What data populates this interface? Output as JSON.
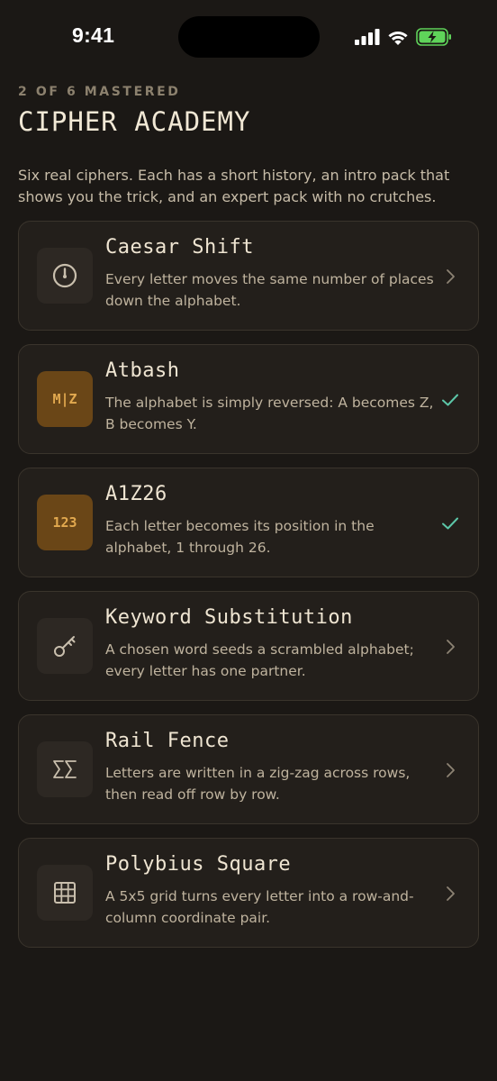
{
  "status_bar": {
    "time": "9:41"
  },
  "header": {
    "progress": "2 OF 6 MASTERED",
    "title": "CIPHER ACADEMY",
    "intro": "Six real ciphers. Each has a short history, an intro pack that shows you the trick, and an expert pack with no crutches."
  },
  "ciphers": [
    {
      "title": "Caesar Shift",
      "desc": "Every letter moves the same number of places down the alphabet.",
      "icon": "dial-icon",
      "mastered": false
    },
    {
      "title": "Atbash",
      "desc": "The alphabet is simply reversed: A becomes Z, B becomes Y.",
      "icon": "mirror-az-icon",
      "icon_text": "M|Z",
      "mastered": true
    },
    {
      "title": "A1Z26",
      "desc": "Each letter becomes its position in the alphabet, 1 through 26.",
      "icon": "numbers-icon",
      "icon_text": "123",
      "mastered": true
    },
    {
      "title": "Keyword Substitution",
      "desc": "A chosen word seeds a scrambled alphabet; every letter has one partner.",
      "icon": "key-icon",
      "mastered": false
    },
    {
      "title": "Rail Fence",
      "desc": "Letters are written in a zig-zag across rows, then read off row by row.",
      "icon": "sigma-icon",
      "icon_text": "Σ",
      "mastered": false
    },
    {
      "title": "Polybius Square",
      "desc": "A 5x5 grid turns every letter into a row-and-column coordinate pair.",
      "icon": "grid-icon",
      "mastered": false
    }
  ],
  "colors": {
    "background": "#1b1815",
    "card": "#231f1b",
    "accent_amber": "#e2a94f",
    "check_teal": "#5cc6a8",
    "battery_green": "#5fd35a"
  }
}
